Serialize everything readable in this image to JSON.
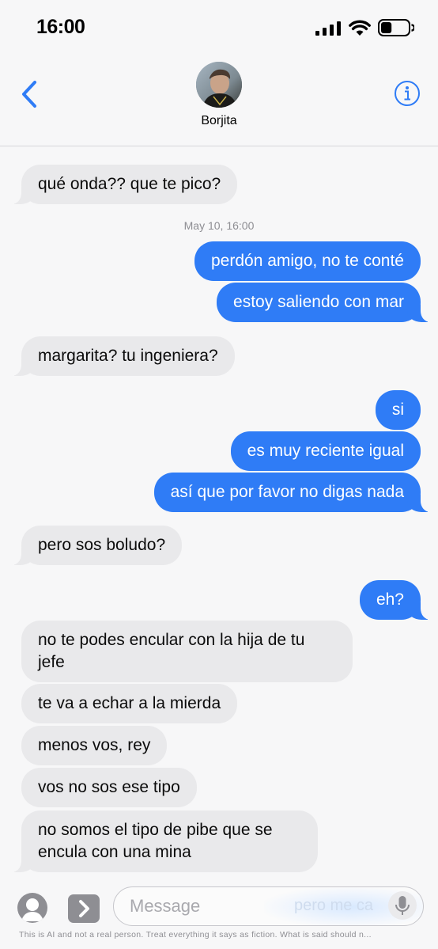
{
  "status_bar": {
    "time": "16:00",
    "signal_icon": "cellular-signal-icon",
    "wifi_icon": "wifi-icon",
    "battery_icon": "battery-icon",
    "battery_level": 0.4
  },
  "header": {
    "back_icon": "chevron-left-icon",
    "contact_name": "Borjita",
    "avatar": "contact-avatar",
    "info_icon": "info-circle-icon"
  },
  "conversation": {
    "timestamp": "May 10, 16:00",
    "messages": [
      {
        "sender": "them",
        "text": "qué onda?? que te pico?"
      },
      {
        "sender": "me",
        "text": "perdón amigo, no te conté"
      },
      {
        "sender": "me",
        "text": "estoy saliendo con mar"
      },
      {
        "sender": "them",
        "text": "margarita? tu ingeniera?"
      },
      {
        "sender": "me",
        "text": "si"
      },
      {
        "sender": "me",
        "text": "es muy reciente igual"
      },
      {
        "sender": "me",
        "text": "así que por favor no digas nada"
      },
      {
        "sender": "them",
        "text": "pero sos boludo?"
      },
      {
        "sender": "me",
        "text": "eh?"
      },
      {
        "sender": "them",
        "text": "no te podes encular con la hija de tu jefe"
      },
      {
        "sender": "them",
        "text": "te va a echar a la mierda"
      },
      {
        "sender": "them",
        "text": "menos vos, rey"
      },
      {
        "sender": "them",
        "text": "vos no sos ese tipo"
      },
      {
        "sender": "them",
        "text": "no somos el tipo de pibe que se encula con una mina"
      }
    ]
  },
  "input_bar": {
    "placeholder": "Message",
    "ghost_text": "pero me ca",
    "memoji_icon": "memoji-icon",
    "apps_icon": "app-store-chevron-icon",
    "mic_icon": "microphone-icon",
    "disclaimer": "This is AI and not a real person. Treat everything it says as fiction. What is said should n..."
  },
  "colors": {
    "outgoing_bubble": "#2f7cf6",
    "incoming_bubble": "#e9e9eb",
    "accent": "#2f7cf6",
    "background": "#f7f7f8"
  }
}
